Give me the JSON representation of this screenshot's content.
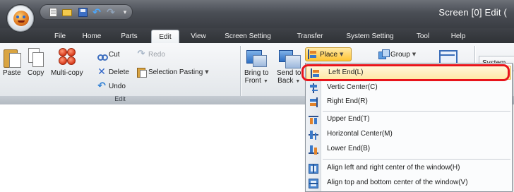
{
  "window": {
    "title": "Screen [0] Edit ("
  },
  "qat": {
    "icons": [
      "new-icon",
      "open-folder-icon",
      "save-icon",
      "undo-icon",
      "redo-icon",
      "customize-dropdown-icon"
    ]
  },
  "tabs": [
    {
      "label": "File"
    },
    {
      "label": "Home"
    },
    {
      "label": "Parts"
    },
    {
      "label": "Edit",
      "active": true
    },
    {
      "label": "View"
    },
    {
      "label": "Screen Setting"
    },
    {
      "label": "Transfer"
    },
    {
      "label": "System Setting"
    },
    {
      "label": "Tool"
    },
    {
      "label": "Help"
    }
  ],
  "ribbon": {
    "edit_group": {
      "label": "Edit",
      "paste": "Paste",
      "copy": "Copy",
      "multicopy": "Multi-copy",
      "cut": "Cut",
      "delete": "Delete",
      "undo": "Undo",
      "redo": "Redo",
      "selection_pasting": "Selection Pasting"
    },
    "arrange_group": {
      "bring_to_front_1": "Bring to",
      "bring_to_front_2": "Front",
      "send_to_back_1": "Send to",
      "send_to_back_2": "Back",
      "place": "Place",
      "group": "Group"
    },
    "system_partial": "System"
  },
  "place_menu": {
    "items": [
      {
        "label": "Left End(L)",
        "icon": "align-left-end-icon",
        "highlighted": true
      },
      {
        "label": "Vertic Center(C)",
        "icon": "align-vertical-center-icon"
      },
      {
        "label": "Right End(R)",
        "icon": "align-right-end-icon"
      },
      {
        "label": "Upper End(T)",
        "icon": "align-upper-end-icon"
      },
      {
        "label": "Horizontal Center(M)",
        "icon": "align-horizontal-center-icon"
      },
      {
        "label": "Lower End(B)",
        "icon": "align-lower-end-icon"
      },
      {
        "label": "Align left and right center of the window(H)",
        "icon": "window-center-horizontal-icon"
      },
      {
        "label": "Align top and bottom center of the window(V)",
        "icon": "window-center-vertical-icon"
      }
    ]
  },
  "colors": {
    "highlight_callout": "#e8141b",
    "place_button": "#ffd66b",
    "menu_hover": "#ffe8a6"
  }
}
